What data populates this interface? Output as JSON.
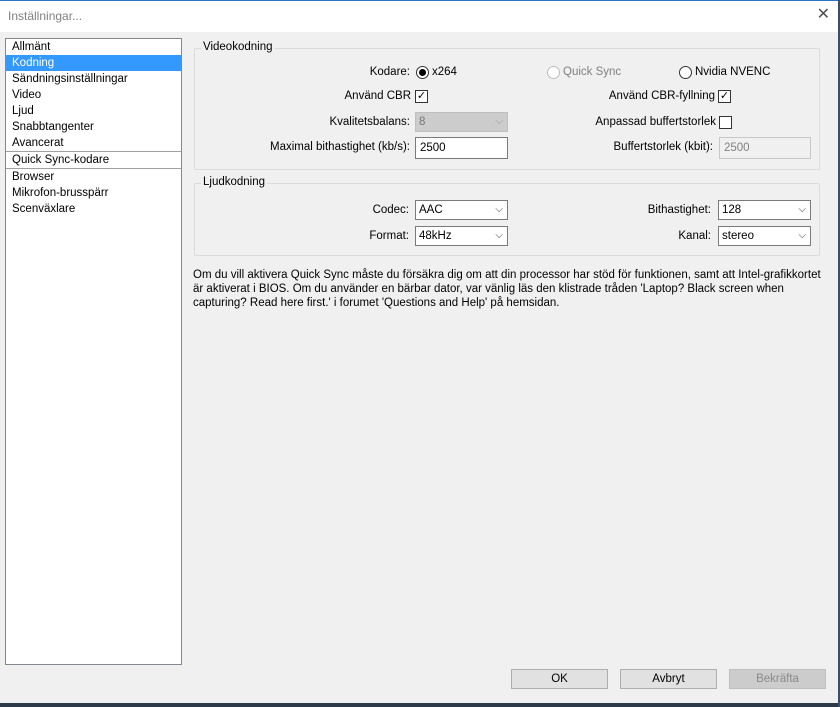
{
  "window": {
    "title": "Inställningar...",
    "close_glyph": "✕"
  },
  "sidebar": {
    "items": [
      {
        "label": "Allmänt"
      },
      {
        "label": "Kodning"
      },
      {
        "label": "Sändningsinställningar"
      },
      {
        "label": "Video"
      },
      {
        "label": "Ljud"
      },
      {
        "label": "Snabbtangenter"
      },
      {
        "label": "Avancerat"
      },
      {
        "label": "Quick Sync-kodare"
      },
      {
        "label": "Browser"
      },
      {
        "label": "Mikrofon-brusspärr"
      },
      {
        "label": "Scenväxlare"
      }
    ],
    "selected": "Kodning"
  },
  "video": {
    "group_title": "Videokodning",
    "encoder_label": "Kodare:",
    "options": {
      "x264": "x264",
      "qsv": "Quick Sync",
      "nvenc": "Nvidia NVENC"
    },
    "selected_encoder": "x264",
    "cbr_label": "Använd CBR",
    "cbr_checked": true,
    "cbr_mark": "✓",
    "cbr_padding_label": "Använd CBR-fyllning",
    "cbr_padding_checked": true,
    "cbr_padding_mark": "✓",
    "quality_label": "Kvalitetsbalans:",
    "quality_value": "8",
    "custom_buffer_label": "Anpassad buffertstorlek",
    "custom_buffer_checked": false,
    "max_bitrate_label": "Maximal bithastighet (kb/s):",
    "max_bitrate_value": "2500",
    "buffer_size_label": "Buffertstorlek (kbit):",
    "buffer_size_value": "2500"
  },
  "audio": {
    "group_title": "Ljudkodning",
    "codec_label": "Codec:",
    "codec_value": "AAC",
    "bitrate_label": "Bithastighet:",
    "bitrate_value": "128",
    "format_label": "Format:",
    "format_value": "48kHz",
    "channel_label": "Kanal:",
    "channel_value": "stereo"
  },
  "info_text": "Om du vill aktivera Quick Sync måste du försäkra dig om att din processor har stöd för funktionen, samt att Intel-grafikkortet är aktiverat i BIOS. Om du använder en bärbar dator, var vänlig läs den klistrade tråden 'Laptop? Black screen when capturing? Read here first.' i forumet 'Questions and Help' på hemsidan.",
  "buttons": {
    "ok": "OK",
    "cancel": "Avbryt",
    "apply": "Bekräfta"
  },
  "icons": {
    "dropdown": "chevron-down-icon",
    "arrow_glyph": "⌵"
  },
  "colors": {
    "selection": "#3399ff",
    "window_bg": "#f0f0f0",
    "titlebar_border": "#2b73c5"
  }
}
